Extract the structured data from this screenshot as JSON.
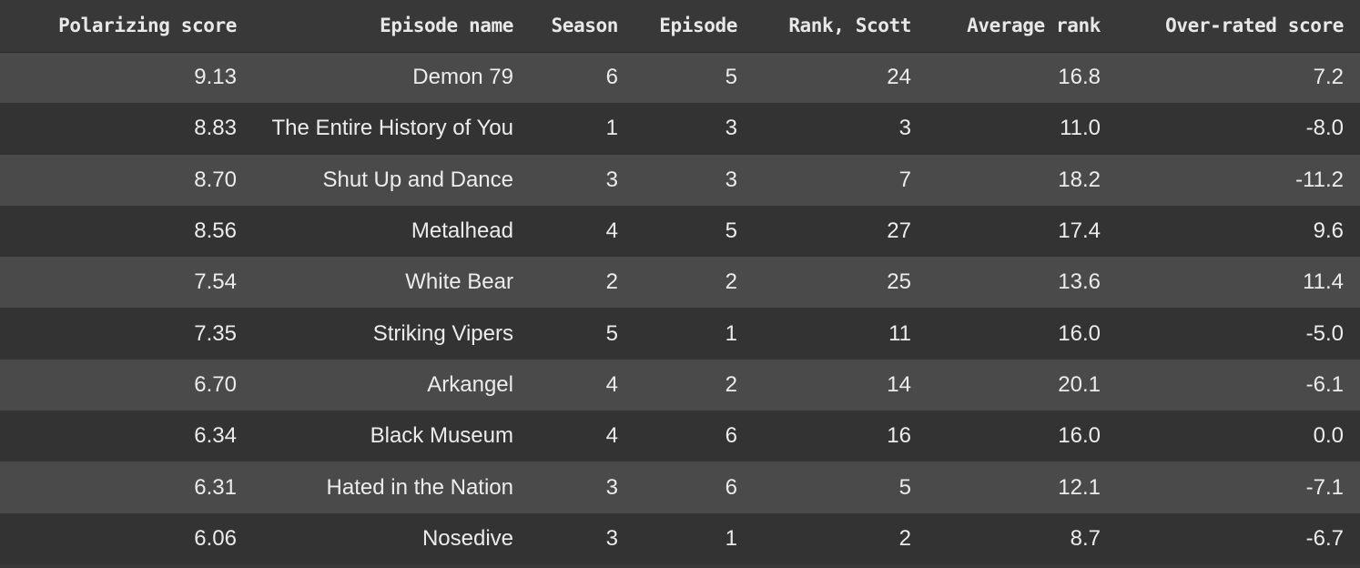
{
  "table": {
    "columns": [
      "Polarizing score",
      "Episode name",
      "Season",
      "Episode",
      "Rank, Scott",
      "Average rank",
      "Over-rated score"
    ],
    "rows": [
      [
        "9.13",
        "Demon 79",
        "6",
        "5",
        "24",
        "16.8",
        "7.2"
      ],
      [
        "8.83",
        "The Entire History of You",
        "1",
        "3",
        "3",
        "11.0",
        "-8.0"
      ],
      [
        "8.70",
        "Shut Up and Dance",
        "3",
        "3",
        "7",
        "18.2",
        "-11.2"
      ],
      [
        "8.56",
        "Metalhead",
        "4",
        "5",
        "27",
        "17.4",
        "9.6"
      ],
      [
        "7.54",
        "White Bear",
        "2",
        "2",
        "25",
        "13.6",
        "11.4"
      ],
      [
        "7.35",
        "Striking Vipers",
        "5",
        "1",
        "11",
        "16.0",
        "-5.0"
      ],
      [
        "6.70",
        "Arkangel",
        "4",
        "2",
        "14",
        "20.1",
        "-6.1"
      ],
      [
        "6.34",
        "Black Museum",
        "4",
        "6",
        "16",
        "16.0",
        "0.0"
      ],
      [
        "6.31",
        "Hated in the Nation",
        "3",
        "6",
        "5",
        "12.1",
        "-7.1"
      ],
      [
        "6.06",
        "Nosedive",
        "3",
        "1",
        "2",
        "8.7",
        "-6.7"
      ]
    ]
  },
  "colors": {
    "header_bg": "#383838",
    "row_odd_bg": "#4a4a4a",
    "row_even_bg": "#333333",
    "text": "#ececec"
  }
}
